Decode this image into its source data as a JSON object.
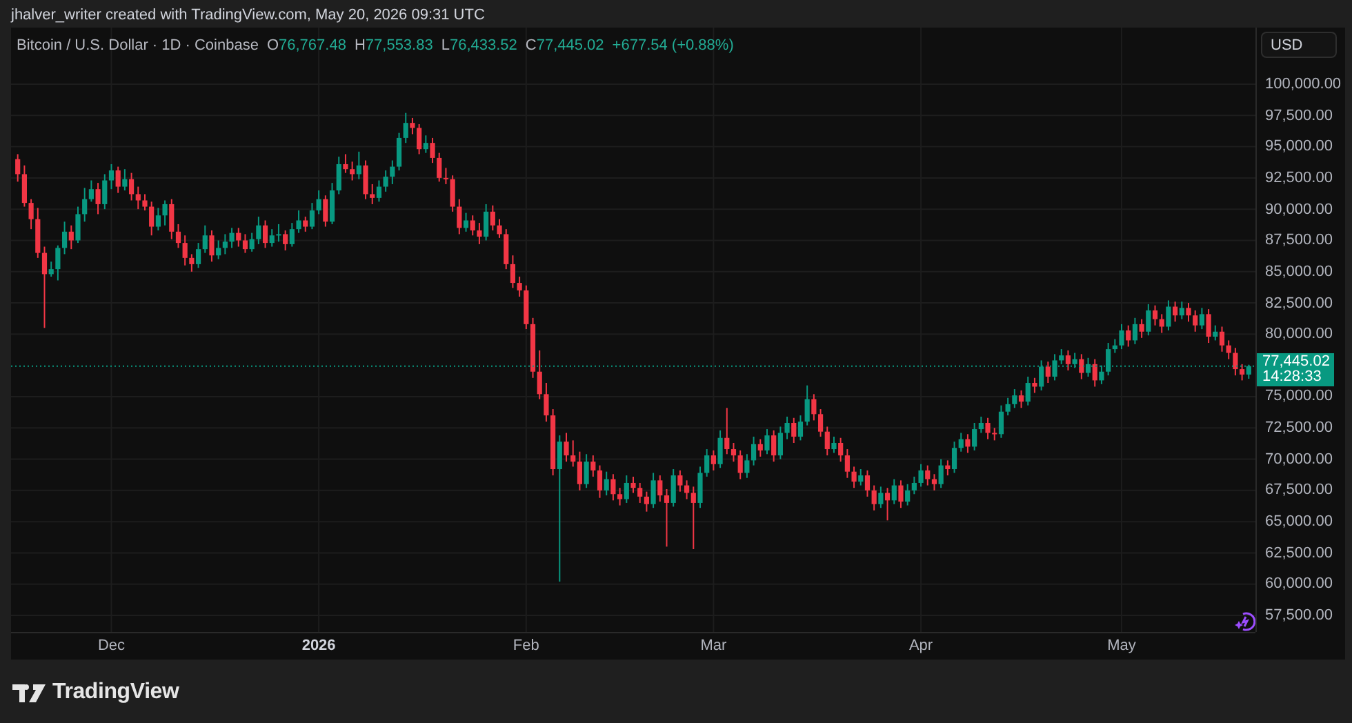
{
  "attribution": "jhalver_writer created with TradingView.com, May 20, 2026 09:31 UTC",
  "legend": {
    "symbol": "Bitcoin / U.S. Dollar · 1D · Coinbase",
    "values": [
      {
        "label": "O",
        "value": "76,767.48"
      },
      {
        "label": "H",
        "value": "77,553.83"
      },
      {
        "label": "L",
        "value": "76,433.52"
      },
      {
        "label": "C",
        "value": "77,445.02"
      }
    ],
    "change": "+677.54 (+0.88%)"
  },
  "currency_button": "USD",
  "chart_data": {
    "type": "candlestick",
    "x": [
      "2025-11-17",
      "2025-11-18",
      "2025-11-19",
      "2025-11-20",
      "2025-11-21",
      "2025-11-22",
      "2025-11-23",
      "2025-11-24",
      "2025-11-25",
      "2025-11-26",
      "2025-11-27",
      "2025-11-28",
      "2025-11-29",
      "2025-11-30",
      "2025-12-01",
      "2025-12-02",
      "2025-12-03",
      "2025-12-04",
      "2025-12-05",
      "2025-12-06",
      "2025-12-07",
      "2025-12-08",
      "2025-12-09",
      "2025-12-10",
      "2025-12-11",
      "2025-12-12",
      "2025-12-13",
      "2025-12-14",
      "2025-12-15",
      "2025-12-16",
      "2025-12-17",
      "2025-12-18",
      "2025-12-19",
      "2025-12-20",
      "2025-12-21",
      "2025-12-22",
      "2025-12-23",
      "2025-12-24",
      "2025-12-25",
      "2025-12-26",
      "2025-12-27",
      "2025-12-28",
      "2025-12-29",
      "2025-12-30",
      "2025-12-31",
      "2026-01-01",
      "2026-01-02",
      "2026-01-03",
      "2026-01-04",
      "2026-01-05",
      "2026-01-06",
      "2026-01-07",
      "2026-01-08",
      "2026-01-09",
      "2026-01-10",
      "2026-01-11",
      "2026-01-12",
      "2026-01-13",
      "2026-01-14",
      "2026-01-15",
      "2026-01-16",
      "2026-01-17",
      "2026-01-18",
      "2026-01-19",
      "2026-01-20",
      "2026-01-21",
      "2026-01-22",
      "2026-01-23",
      "2026-01-24",
      "2026-01-25",
      "2026-01-26",
      "2026-01-27",
      "2026-01-28",
      "2026-01-29",
      "2026-01-30",
      "2026-01-31",
      "2026-02-01",
      "2026-02-02",
      "2026-02-03",
      "2026-02-04",
      "2026-02-05",
      "2026-02-06",
      "2026-02-07",
      "2026-02-08",
      "2026-02-09",
      "2026-02-10",
      "2026-02-11",
      "2026-02-12",
      "2026-02-13",
      "2026-02-14",
      "2026-02-15",
      "2026-02-16",
      "2026-02-17",
      "2026-02-18",
      "2026-02-19",
      "2026-02-20",
      "2026-02-21",
      "2026-02-22",
      "2026-02-23",
      "2026-02-24",
      "2026-02-25",
      "2026-02-26",
      "2026-02-27",
      "2026-02-28",
      "2026-03-01",
      "2026-03-02",
      "2026-03-03",
      "2026-03-04",
      "2026-03-05",
      "2026-03-06",
      "2026-03-07",
      "2026-03-08",
      "2026-03-09",
      "2026-03-10",
      "2026-03-11",
      "2026-03-12",
      "2026-03-13",
      "2026-03-14",
      "2026-03-15",
      "2026-03-16",
      "2026-03-17",
      "2026-03-18",
      "2026-03-19",
      "2026-03-20",
      "2026-03-21",
      "2026-03-22",
      "2026-03-23",
      "2026-03-24",
      "2026-03-25",
      "2026-03-26",
      "2026-03-27",
      "2026-03-28",
      "2026-03-29",
      "2026-03-30",
      "2026-03-31",
      "2026-04-01",
      "2026-04-02",
      "2026-04-03",
      "2026-04-04",
      "2026-04-05",
      "2026-04-06",
      "2026-04-07",
      "2026-04-08",
      "2026-04-09",
      "2026-04-10",
      "2026-04-11",
      "2026-04-12",
      "2026-04-13",
      "2026-04-14",
      "2026-04-15",
      "2026-04-16",
      "2026-04-17",
      "2026-04-18",
      "2026-04-19",
      "2026-04-20",
      "2026-04-21",
      "2026-04-22",
      "2026-04-23",
      "2026-04-24",
      "2026-04-25",
      "2026-04-26",
      "2026-04-27",
      "2026-04-28",
      "2026-04-29",
      "2026-04-30",
      "2026-05-01",
      "2026-05-02",
      "2026-05-03",
      "2026-05-04",
      "2026-05-05",
      "2026-05-06",
      "2026-05-07",
      "2026-05-08",
      "2026-05-09",
      "2026-05-10",
      "2026-05-11",
      "2026-05-12",
      "2026-05-13",
      "2026-05-14",
      "2026-05-15",
      "2026-05-16",
      "2026-05-17",
      "2026-05-18",
      "2026-05-19",
      "2026-05-20"
    ],
    "ohlc": [
      [
        94000,
        94400,
        92200,
        92800
      ],
      [
        92800,
        93500,
        90200,
        90500
      ],
      [
        90500,
        90800,
        88400,
        89200
      ],
      [
        89200,
        90100,
        86100,
        86500
      ],
      [
        86500,
        87000,
        80500,
        84800
      ],
      [
        84800,
        85800,
        84600,
        85200
      ],
      [
        85200,
        87100,
        84300,
        86900
      ],
      [
        86900,
        89000,
        86400,
        88200
      ],
      [
        88200,
        88700,
        86800,
        87500
      ],
      [
        87500,
        90200,
        87300,
        89600
      ],
      [
        89600,
        91700,
        89000,
        90800
      ],
      [
        90800,
        92300,
        90600,
        91600
      ],
      [
        91600,
        92100,
        89600,
        90400
      ],
      [
        90400,
        92800,
        90000,
        92300
      ],
      [
        92300,
        93600,
        91600,
        93100
      ],
      [
        93100,
        93400,
        91300,
        91800
      ],
      [
        91800,
        93200,
        91500,
        92400
      ],
      [
        92400,
        92900,
        90700,
        91200
      ],
      [
        91200,
        91800,
        90000,
        90700
      ],
      [
        90700,
        91200,
        89900,
        90200
      ],
      [
        90200,
        90600,
        87900,
        88600
      ],
      [
        88600,
        90100,
        88300,
        89500
      ],
      [
        89500,
        90700,
        88700,
        90400
      ],
      [
        90400,
        90800,
        87600,
        88200
      ],
      [
        88200,
        88800,
        86900,
        87300
      ],
      [
        87300,
        87900,
        85500,
        86100
      ],
      [
        86100,
        86400,
        85000,
        85600
      ],
      [
        85600,
        87300,
        85300,
        86800
      ],
      [
        86800,
        88700,
        86500,
        87900
      ],
      [
        87900,
        88300,
        85800,
        86300
      ],
      [
        86300,
        87500,
        86000,
        86900
      ],
      [
        86900,
        88000,
        86400,
        87400
      ],
      [
        87400,
        88500,
        86900,
        88100
      ],
      [
        88100,
        88500,
        87000,
        87500
      ],
      [
        87500,
        88000,
        86500,
        86800
      ],
      [
        86800,
        88100,
        86600,
        87600
      ],
      [
        87600,
        89400,
        87200,
        88700
      ],
      [
        88700,
        89100,
        86900,
        87300
      ],
      [
        87300,
        88400,
        87000,
        87900
      ],
      [
        87900,
        88800,
        87400,
        88000
      ],
      [
        88000,
        88300,
        86700,
        87200
      ],
      [
        87200,
        88900,
        87000,
        88400
      ],
      [
        88400,
        89900,
        88100,
        89100
      ],
      [
        89100,
        89400,
        88200,
        88600
      ],
      [
        88600,
        90500,
        88400,
        89900
      ],
      [
        89900,
        91500,
        89600,
        90800
      ],
      [
        90800,
        91100,
        88600,
        89000
      ],
      [
        89000,
        92100,
        88800,
        91500
      ],
      [
        91500,
        94200,
        91200,
        93600
      ],
      [
        93600,
        94400,
        92900,
        93200
      ],
      [
        93200,
        93800,
        92300,
        92800
      ],
      [
        92800,
        94600,
        92400,
        93500
      ],
      [
        93500,
        93900,
        90800,
        91200
      ],
      [
        91200,
        92000,
        90400,
        90900
      ],
      [
        90900,
        92300,
        90600,
        91800
      ],
      [
        91800,
        93100,
        91400,
        92600
      ],
      [
        92600,
        93900,
        92000,
        93400
      ],
      [
        93400,
        96100,
        93100,
        95700
      ],
      [
        95700,
        97700,
        95300,
        96900
      ],
      [
        96900,
        97300,
        96000,
        96500
      ],
      [
        96500,
        96800,
        94400,
        94800
      ],
      [
        94800,
        95900,
        94500,
        95300
      ],
      [
        95300,
        95700,
        93700,
        94100
      ],
      [
        94100,
        94500,
        92200,
        92500
      ],
      [
        92500,
        93300,
        92000,
        92400
      ],
      [
        92400,
        92700,
        89800,
        90200
      ],
      [
        90200,
        90800,
        88000,
        88500
      ],
      [
        88500,
        89700,
        88200,
        89100
      ],
      [
        89100,
        89500,
        87900,
        88300
      ],
      [
        88300,
        88900,
        87200,
        87800
      ],
      [
        87800,
        90400,
        87500,
        89800
      ],
      [
        89800,
        90300,
        88300,
        88700
      ],
      [
        88700,
        89200,
        87700,
        88000
      ],
      [
        88000,
        88400,
        85200,
        85600
      ],
      [
        85600,
        86300,
        83700,
        84100
      ],
      [
        84100,
        84600,
        83000,
        83500
      ],
      [
        83500,
        83900,
        80400,
        80800
      ],
      [
        80800,
        81300,
        76500,
        77000
      ],
      [
        77000,
        78700,
        74800,
        75200
      ],
      [
        75200,
        76100,
        73000,
        73500
      ],
      [
        73500,
        74000,
        68700,
        69200
      ],
      [
        69200,
        71900,
        60200,
        71400
      ],
      [
        71400,
        72100,
        69800,
        70300
      ],
      [
        70300,
        71500,
        69400,
        69800
      ],
      [
        69800,
        70600,
        67500,
        68000
      ],
      [
        68000,
        70400,
        67700,
        69800
      ],
      [
        69800,
        70300,
        68600,
        69100
      ],
      [
        69100,
        69500,
        66900,
        67500
      ],
      [
        67500,
        69000,
        67100,
        68400
      ],
      [
        68400,
        68800,
        66700,
        67200
      ],
      [
        67200,
        67700,
        66300,
        66800
      ],
      [
        66800,
        68700,
        66500,
        68100
      ],
      [
        68100,
        68600,
        67300,
        67700
      ],
      [
        67700,
        68100,
        66500,
        67000
      ],
      [
        67000,
        67400,
        65800,
        66400
      ],
      [
        66400,
        68900,
        66100,
        68300
      ],
      [
        68300,
        68700,
        66600,
        67100
      ],
      [
        67100,
        67600,
        63000,
        66500
      ],
      [
        66500,
        69200,
        66200,
        68700
      ],
      [
        68700,
        69100,
        67400,
        67900
      ],
      [
        67900,
        68300,
        66800,
        67300
      ],
      [
        67300,
        67800,
        62800,
        66500
      ],
      [
        66500,
        69400,
        66100,
        68900
      ],
      [
        68900,
        70800,
        68600,
        70300
      ],
      [
        70300,
        70700,
        69100,
        69600
      ],
      [
        69600,
        72300,
        69300,
        71700
      ],
      [
        71700,
        74100,
        70400,
        70800
      ],
      [
        70800,
        71300,
        69800,
        70300
      ],
      [
        70300,
        70700,
        68400,
        68900
      ],
      [
        68900,
        70400,
        68500,
        69900
      ],
      [
        69900,
        71800,
        69500,
        71200
      ],
      [
        71200,
        71600,
        70200,
        70700
      ],
      [
        70700,
        72400,
        70400,
        71900
      ],
      [
        71900,
        72300,
        69800,
        70300
      ],
      [
        70300,
        72600,
        70000,
        72100
      ],
      [
        72100,
        73400,
        71600,
        72900
      ],
      [
        72900,
        73300,
        71300,
        71800
      ],
      [
        71800,
        73500,
        71500,
        73000
      ],
      [
        73000,
        75900,
        72700,
        74800
      ],
      [
        74800,
        75200,
        73100,
        73600
      ],
      [
        73600,
        74000,
        71800,
        72200
      ],
      [
        72200,
        72600,
        70300,
        70800
      ],
      [
        70800,
        71800,
        70500,
        71300
      ],
      [
        71300,
        71700,
        69800,
        70300
      ],
      [
        70300,
        70800,
        68500,
        69000
      ],
      [
        69000,
        69400,
        67700,
        68200
      ],
      [
        68200,
        69200,
        67900,
        68700
      ],
      [
        68700,
        69100,
        67000,
        67500
      ],
      [
        67500,
        67900,
        65900,
        66400
      ],
      [
        66400,
        67800,
        66100,
        67300
      ],
      [
        67300,
        67700,
        65100,
        66700
      ],
      [
        66700,
        68400,
        66400,
        67900
      ],
      [
        67900,
        68300,
        66100,
        66600
      ],
      [
        66600,
        68000,
        66300,
        67500
      ],
      [
        67500,
        68600,
        67200,
        68100
      ],
      [
        68100,
        69600,
        67800,
        69100
      ],
      [
        69100,
        69500,
        67900,
        68400
      ],
      [
        68400,
        68800,
        67500,
        68000
      ],
      [
        68000,
        70000,
        67700,
        69500
      ],
      [
        69500,
        69900,
        68700,
        69200
      ],
      [
        69200,
        71400,
        68900,
        70900
      ],
      [
        70900,
        72100,
        70600,
        71600
      ],
      [
        71600,
        72000,
        70500,
        71000
      ],
      [
        71000,
        72900,
        70700,
        72400
      ],
      [
        72400,
        73400,
        72100,
        72900
      ],
      [
        72900,
        73300,
        71600,
        72100
      ],
      [
        72100,
        72500,
        71500,
        72000
      ],
      [
        72000,
        74300,
        71700,
        73800
      ],
      [
        73800,
        74900,
        73500,
        74400
      ],
      [
        74400,
        75600,
        74100,
        75100
      ],
      [
        75100,
        75500,
        74100,
        74600
      ],
      [
        74600,
        76600,
        74300,
        76100
      ],
      [
        76100,
        76500,
        75300,
        75800
      ],
      [
        75800,
        77900,
        75500,
        77400
      ],
      [
        77400,
        77800,
        76100,
        76600
      ],
      [
        76600,
        78400,
        76300,
        77900
      ],
      [
        77900,
        78800,
        77600,
        78300
      ],
      [
        78300,
        78700,
        77100,
        77600
      ],
      [
        77600,
        78500,
        77300,
        78000
      ],
      [
        78000,
        78400,
        76400,
        76900
      ],
      [
        76900,
        78100,
        76600,
        77600
      ],
      [
        77600,
        78000,
        75800,
        76300
      ],
      [
        76300,
        77500,
        76000,
        77000
      ],
      [
        77000,
        79300,
        76700,
        78800
      ],
      [
        78800,
        79600,
        78500,
        79100
      ],
      [
        79100,
        80800,
        78800,
        80300
      ],
      [
        80300,
        80700,
        79000,
        79500
      ],
      [
        79500,
        81300,
        79200,
        80800
      ],
      [
        80800,
        81200,
        79700,
        80200
      ],
      [
        80200,
        82400,
        79900,
        81900
      ],
      [
        81900,
        82300,
        80700,
        81200
      ],
      [
        81200,
        81600,
        80100,
        80600
      ],
      [
        80600,
        82700,
        80300,
        82200
      ],
      [
        82200,
        82600,
        81000,
        81500
      ],
      [
        81500,
        82600,
        81200,
        82100
      ],
      [
        82100,
        82500,
        81000,
        81500
      ],
      [
        81500,
        81900,
        80200,
        80700
      ],
      [
        80700,
        82100,
        80400,
        81600
      ],
      [
        81600,
        82000,
        79300,
        79800
      ],
      [
        79800,
        80700,
        79500,
        80200
      ],
      [
        80200,
        80600,
        78600,
        79100
      ],
      [
        79100,
        79500,
        78000,
        78500
      ],
      [
        78500,
        78900,
        76700,
        77200
      ],
      [
        77200,
        77600,
        76300,
        76767
      ],
      [
        76767,
        77554,
        76434,
        77445
      ]
    ],
    "xlim": [
      "2025-11-16",
      "2026-05-21"
    ],
    "ylim": [
      56176,
      104526
    ],
    "xticks": [
      {
        "value": "2025-12-01",
        "label": "Dec"
      },
      {
        "value": "2026-01-01",
        "label": "2026"
      },
      {
        "value": "2026-02-01",
        "label": "Feb"
      },
      {
        "value": "2026-03-01",
        "label": "Mar"
      },
      {
        "value": "2026-04-01",
        "label": "Apr"
      },
      {
        "value": "2026-05-01",
        "label": "May"
      }
    ],
    "grid": true,
    "ref_lines": [
      {
        "axis": "y",
        "value": 77445.02,
        "color": "#089981"
      }
    ],
    "yticks": [
      {
        "value": 100000,
        "label": "100,000.00"
      },
      {
        "value": 97500,
        "label": "97,500.00"
      },
      {
        "value": 95000,
        "label": "95,000.00"
      },
      {
        "value": 92500,
        "label": "92,500.00"
      },
      {
        "value": 90000,
        "label": "90,000.00"
      },
      {
        "value": 87500,
        "label": "87,500.00"
      },
      {
        "value": 85000,
        "label": "85,000.00"
      },
      {
        "value": 82500,
        "label": "82,500.00"
      },
      {
        "value": 80000,
        "label": "80,000.00"
      },
      {
        "value": 75000,
        "label": "75,000.00"
      },
      {
        "value": 72500,
        "label": "72,500.00"
      },
      {
        "value": 70000,
        "label": "70,000.00"
      },
      {
        "value": 67500,
        "label": "67,500.00"
      },
      {
        "value": 65000,
        "label": "65,000.00"
      },
      {
        "value": 62500,
        "label": "62,500.00"
      },
      {
        "value": 60000,
        "label": "60,000.00"
      },
      {
        "value": 57500,
        "label": "57,500.00"
      }
    ]
  },
  "last_price": {
    "value": "77,445.02",
    "countdown": "14:28:33"
  },
  "logo": "TradingView"
}
